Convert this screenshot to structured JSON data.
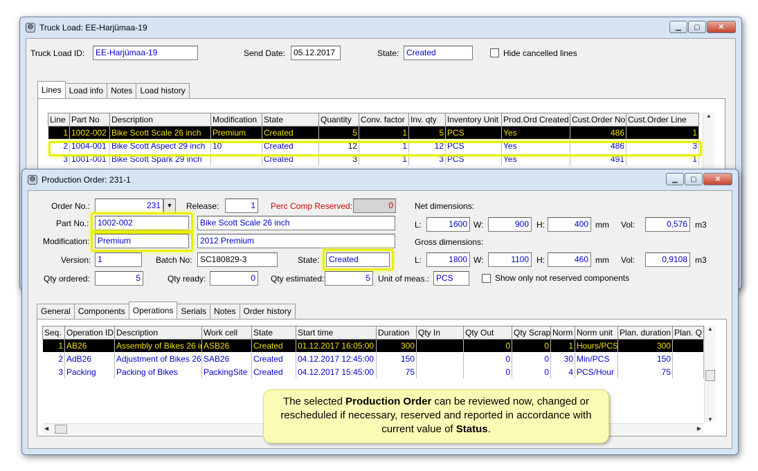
{
  "truck": {
    "title": "Truck Load: EE-Harjümaa-19",
    "id_label": "Truck Load ID:",
    "id_value": "EE-Harjümaa-19",
    "send_date_label": "Send Date:",
    "send_date_value": "05.12.2017",
    "state_label": "State:",
    "state_value": "Created",
    "hide_cancelled_label": "Hide cancelled lines",
    "tabs": [
      "Lines",
      "Load info",
      "Notes",
      "Load history"
    ],
    "columns": [
      "Line",
      "Part No",
      "Description",
      "Modification",
      "State",
      "Quantity",
      "Conv. factor",
      "Inv. qty",
      "Inventory Unit",
      "Prod.Ord Created",
      "Cust.Order No",
      "Cust.Order Line"
    ],
    "rows": [
      [
        "1",
        "1002-002",
        "Bike Scott Scale 26 inch",
        "Premium",
        "Created",
        "5",
        "1",
        "5",
        "PCS",
        "Yes",
        "486",
        "1"
      ],
      [
        "2",
        "1004-001",
        "Bike Scott Aspect 29 inch",
        "10",
        "Created",
        "12",
        "1",
        "12",
        "PCS",
        "Yes",
        "486",
        "3"
      ],
      [
        "3",
        "1001-001",
        "Bike Scott Spark 29 inch",
        "",
        "Created",
        "3",
        "1",
        "3",
        "PCS",
        "Yes",
        "491",
        "1"
      ]
    ]
  },
  "prod": {
    "title": "Production Order: 231-1",
    "order_no_label": "Order No.:",
    "order_no_value": "231",
    "release_label": "Release:",
    "release_value": "1",
    "perc_label": "Perc Comp Reserved:",
    "perc_value": "0",
    "part_label": "Part No.:",
    "part_value": "1002-002",
    "part_desc": "Bike Scott Scale 26 inch",
    "mod_label": "Modification:",
    "mod_value": "Premium",
    "mod_desc": "2012 Premium",
    "version_label": "Version:",
    "version_value": "1",
    "batch_label": "Batch No:",
    "batch_value": "SC180829-3",
    "state_label": "State:",
    "state_value": "Created",
    "qty_ordered_label": "Qty ordered:",
    "qty_ordered_value": "5",
    "qty_ready_label": "Qty ready:",
    "qty_ready_value": "0",
    "qty_est_label": "Qty estimated:",
    "qty_est_value": "5",
    "uom_label": "Unit of meas.:",
    "uom_value": "PCS",
    "show_not_reserved_label": "Show only not reserved components",
    "net_label": "Net dimensions:",
    "gross_label": "Gross dimensions:",
    "l_label": "L:",
    "w_label": "W:",
    "h_label": "H:",
    "mm_label": "mm",
    "vol_label": "Vol:",
    "m3_label": "m3",
    "net_l": "1600",
    "net_w": "900",
    "net_h": "400",
    "net_vol": "0,576",
    "gross_l": "1800",
    "gross_w": "1100",
    "gross_h": "460",
    "gross_vol": "0,9108",
    "tabs": [
      "General",
      "Components",
      "Operations",
      "Serials",
      "Notes",
      "Order history"
    ],
    "columns": [
      "Seq.",
      "Operation ID",
      "Description",
      "Work cell",
      "State",
      "Start time",
      "Duration",
      "Qty In",
      "Qty Out",
      "Qty Scrap",
      "Norm",
      "Norm unit",
      "Plan. duration",
      "Plan. Q"
    ],
    "rows": [
      [
        "1",
        "AB26",
        "Assembly of Bikes 26 in",
        "ASB26",
        "Created",
        "01.12.2017 16:05:00",
        "300",
        "",
        "0",
        "0",
        "1",
        "Hours/PCS",
        "300",
        ""
      ],
      [
        "2",
        "AdB26",
        "Adjustment of Bikes 26",
        "SAB26",
        "Created",
        "04.12.2017 12:45:00",
        "150",
        "",
        "0",
        "0",
        "30",
        "Min/PCS",
        "150",
        ""
      ],
      [
        "3",
        "Packing",
        "Packing of Bikes",
        "PackingSite",
        "Created",
        "04.12.2017 15:45:00",
        "75",
        "",
        "0",
        "0",
        "4",
        "PCS/Hour",
        "75",
        ""
      ]
    ]
  },
  "callout": {
    "t1": "The selected ",
    "b1": "Production  Order",
    "t2": " can be reviewed now, changed or rescheduled if necessary, reserved and reported in accordance with current value of ",
    "b2": "Status",
    "t3": "."
  }
}
